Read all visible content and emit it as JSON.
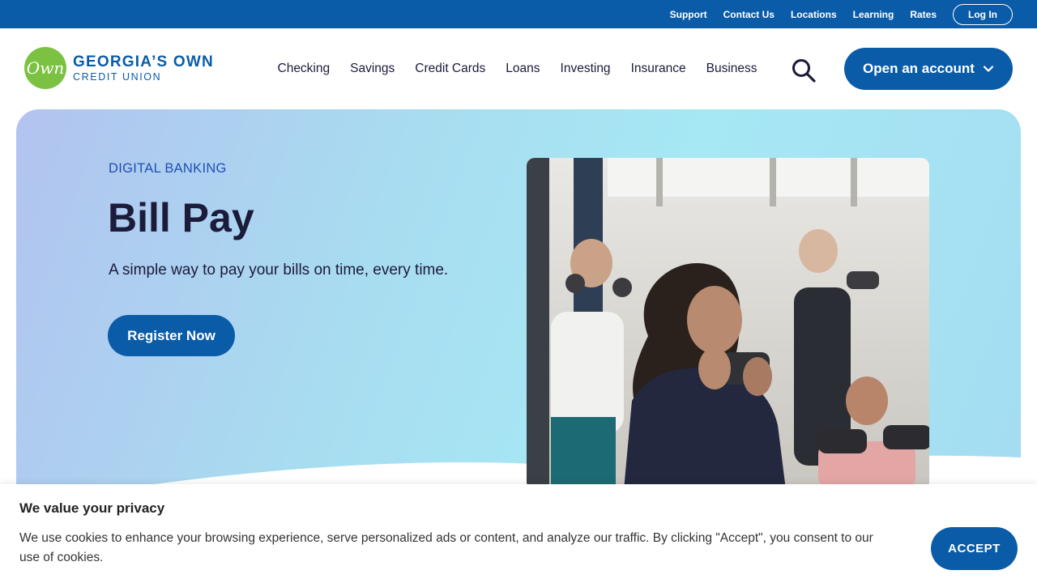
{
  "utility_bar": {
    "links": [
      "Support",
      "Contact Us",
      "Locations",
      "Learning",
      "Rates"
    ],
    "login_label": "Log In"
  },
  "header": {
    "logo": {
      "mark": "Own",
      "line1": "GEORGIA’S OWN",
      "line2": "CREDIT UNION"
    },
    "nav": [
      "Checking",
      "Savings",
      "Credit Cards",
      "Loans",
      "Investing",
      "Insurance",
      "Business"
    ],
    "search_icon": "search-icon",
    "open_account_label": "Open an account"
  },
  "hero": {
    "eyebrow": "DIGITAL BANKING",
    "title": "Bill Pay",
    "subtitle": "A simple way to pay your bills on time, every time.",
    "cta_label": "Register Now"
  },
  "cookie_banner": {
    "title": "We value your privacy",
    "text": "We use cookies to enhance your browsing experience, serve personalized ads or content, and analyze our traffic. By clicking \"Accept\", you consent to our use of cookies.",
    "accept_label": "ACCEPT"
  },
  "colors": {
    "brand_blue": "#0a5ca8",
    "logo_green": "#7cc242",
    "eyebrow_blue": "#1f4fb5"
  }
}
